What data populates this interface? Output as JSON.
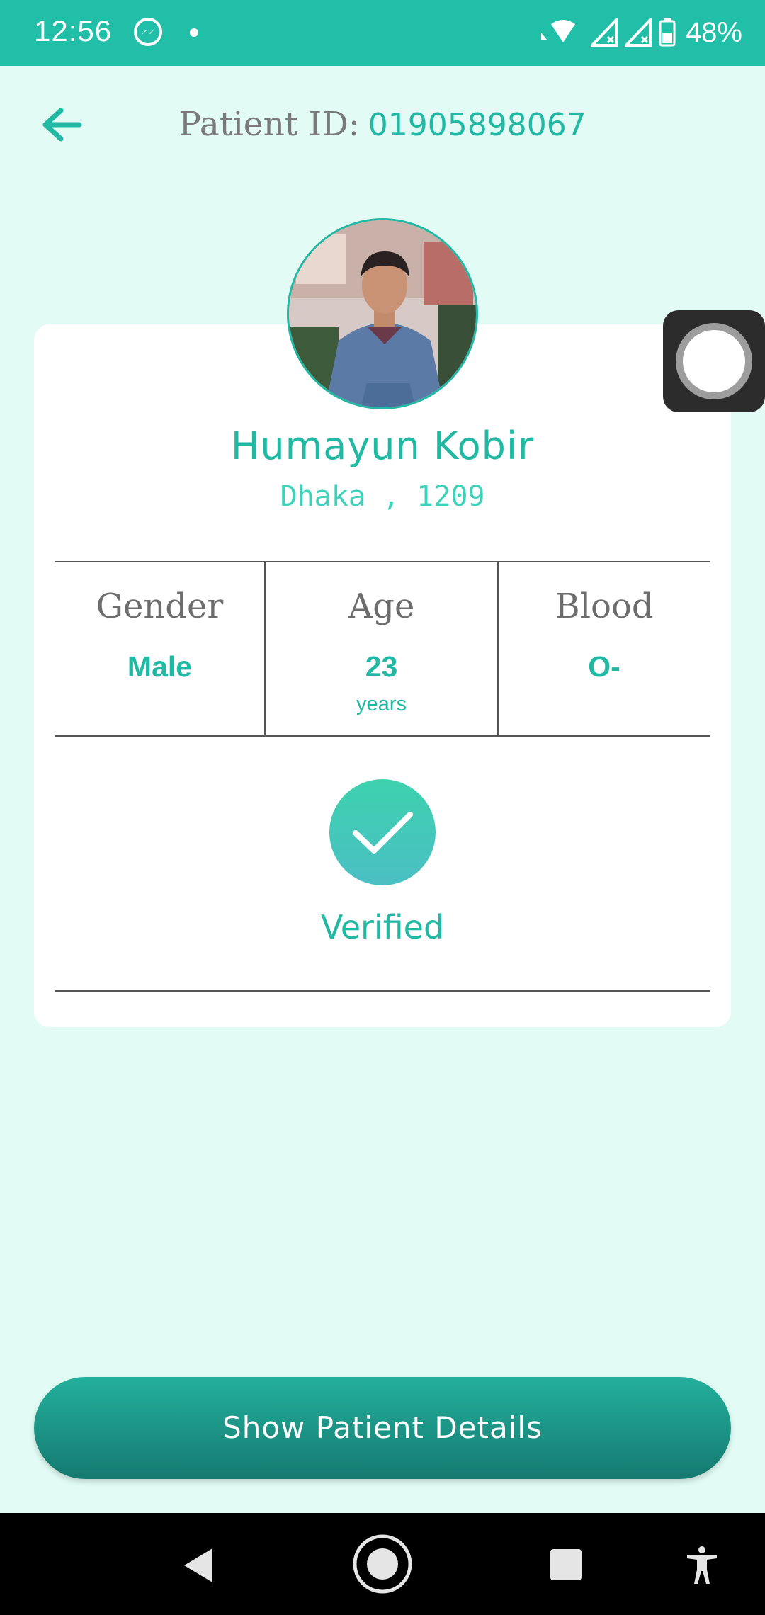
{
  "status_bar": {
    "time": "12:56",
    "battery": "48%",
    "icons": [
      "messenger-icon",
      "notification-dot",
      "wifi-icon",
      "signal-icon",
      "signal-icon",
      "battery-icon"
    ]
  },
  "header": {
    "back_icon": "arrow-left-icon",
    "id_label": "Patient ID:",
    "id_value": "01905898067"
  },
  "profile": {
    "name": "Humayun Kobir",
    "location": "Dhaka , 1209"
  },
  "info": {
    "gender": {
      "label": "Gender",
      "value": "Male"
    },
    "age": {
      "label": "Age",
      "value": "23",
      "unit": "years"
    },
    "blood": {
      "label": "Blood",
      "value": "O-"
    }
  },
  "verification": {
    "icon": "checkmark-icon",
    "label": "Verified"
  },
  "actions": {
    "details_label": "Show Patient Details"
  },
  "nav_bar": {
    "icons": [
      "back-icon",
      "home-icon",
      "recents-icon",
      "accessibility-icon"
    ]
  },
  "colors": {
    "status_bar": "#21bfa8",
    "background": "#e2fcf5",
    "accent": "#22b9a4",
    "button_top": "#23b09c",
    "button_bottom": "#157a70"
  }
}
